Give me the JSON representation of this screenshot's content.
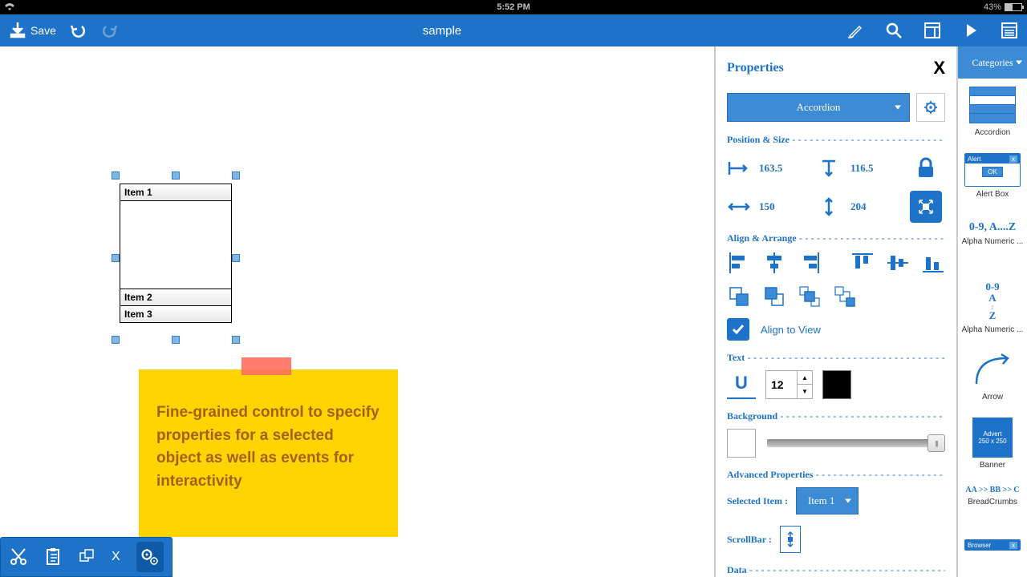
{
  "status": {
    "time": "5:52 PM",
    "battery": "43%"
  },
  "toolbar": {
    "save": "Save",
    "title": "sample"
  },
  "canvas": {
    "accordion": {
      "item1": "Item 1",
      "item2": "Item 2",
      "item3": "Item 3"
    },
    "sticky": "Fine-grained control to specify properties for a selected object as well as events for interactivity"
  },
  "properties": {
    "title": "Properties",
    "dropdown": "Accordion",
    "section_pos": "Position & Size",
    "x": "163.5",
    "y": "116.5",
    "w": "150",
    "h": "204",
    "section_align": "Align & Arrange",
    "align_to_view": "Align to View",
    "section_text": "Text",
    "font_size": "12",
    "section_bg": "Background",
    "section_adv": "Advanced Properties",
    "selected_label": "Selected Item :",
    "selected_value": "Item 1",
    "scrollbar_label": "ScrollBar :",
    "section_data": "Data"
  },
  "categories": {
    "header": "Categories",
    "items": {
      "accordion": "Accordion",
      "alert_hdr": "Alert",
      "alert_box": "Alert Box",
      "alpha1": "0-9, A....Z",
      "alpha1_lbl": "Alpha Numeric ...",
      "alpha2a": "0-9",
      "alpha2b": "A",
      "alpha2c": "Z",
      "alpha2_lbl": "Alpha Numeric ...",
      "arrow": "Arrow",
      "banner_a": "Advert",
      "banner_b": "250 x 250",
      "banner_lbl": "Banner",
      "bread": "AA >> BB >> C",
      "bread_lbl": "BreadCrumbs",
      "browser": "Browser"
    }
  }
}
